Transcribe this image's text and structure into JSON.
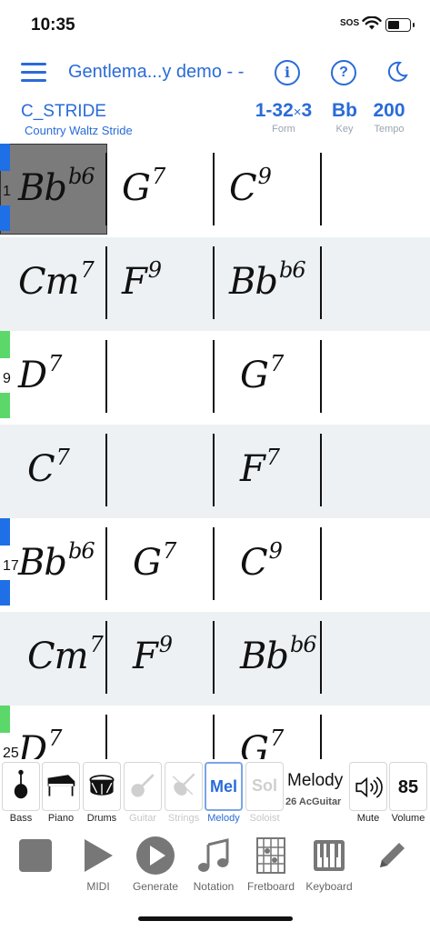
{
  "status": {
    "time": "10:35",
    "sos": "SOS"
  },
  "nav": {
    "title": "Gentlema...y demo - -",
    "info_glyph": "i",
    "help_glyph": "?"
  },
  "style": {
    "name": "C_STRIDE",
    "description": "Country Waltz Stride",
    "form": {
      "range": "1-32",
      "times": "×",
      "repeat": "3",
      "label": "Form"
    },
    "key": {
      "value": "Bb",
      "label": "Key"
    },
    "tempo": {
      "value": "200",
      "label": "Tempo"
    }
  },
  "chart": {
    "rows": [
      {
        "bar_number": "1",
        "marker": "blue",
        "bars": [
          {
            "root": "Bb",
            "ext": "b6"
          },
          {
            "root": "G",
            "ext": "7"
          },
          {
            "root": "C",
            "ext": "9"
          },
          {
            "root": "",
            "ext": ""
          }
        ]
      },
      {
        "bar_number": "",
        "marker": "",
        "bars": [
          {
            "root": "Cm",
            "ext": "7"
          },
          {
            "root": "F",
            "ext": "9"
          },
          {
            "root": "Bb",
            "ext": "b6"
          },
          {
            "root": "",
            "ext": ""
          }
        ]
      },
      {
        "bar_number": "9",
        "marker": "green",
        "bars": [
          {
            "root": "D",
            "ext": "7"
          },
          {
            "root": "",
            "ext": ""
          },
          {
            "root": "G",
            "ext": "7"
          },
          {
            "root": "",
            "ext": ""
          }
        ]
      },
      {
        "bar_number": "",
        "marker": "",
        "bars": [
          {
            "root": "C",
            "ext": "7"
          },
          {
            "root": "",
            "ext": ""
          },
          {
            "root": "F",
            "ext": "7"
          },
          {
            "root": "",
            "ext": ""
          }
        ]
      },
      {
        "bar_number": "17",
        "marker": "blue",
        "bars": [
          {
            "root": "Bb",
            "ext": "b6"
          },
          {
            "root": "G",
            "ext": "7"
          },
          {
            "root": "C",
            "ext": "9"
          },
          {
            "root": "",
            "ext": ""
          }
        ]
      },
      {
        "bar_number": "",
        "marker": "",
        "bars": [
          {
            "root": "Cm",
            "ext": "7"
          },
          {
            "root": "F",
            "ext": "9"
          },
          {
            "root": "Bb",
            "ext": "b6"
          },
          {
            "root": "",
            "ext": ""
          }
        ]
      },
      {
        "bar_number": "25",
        "marker": "green",
        "bars": [
          {
            "root": "D",
            "ext": "7"
          },
          {
            "root": "",
            "ext": ""
          },
          {
            "root": "G",
            "ext": "7"
          },
          {
            "root": "",
            "ext": ""
          }
        ]
      }
    ]
  },
  "mixer": {
    "bass": "Bass",
    "piano": "Piano",
    "drums": "Drums",
    "guitar": "Guitar",
    "strings": "Strings",
    "melody_btn": "Mel",
    "melody": "Melody",
    "soloist_btn": "Sol",
    "soloist": "Soloist",
    "track_name": "Melody",
    "track_instrument": "26 AcGuitar",
    "mute": "Mute",
    "volume_value": "85",
    "volume": "Volume"
  },
  "toolbar": {
    "stop": "",
    "midi": "MIDI",
    "generate": "Generate",
    "notation": "Notation",
    "fretboard": "Fretboard",
    "keyboard": "Keyboard",
    "edit": ""
  },
  "colors": {
    "accent": "#2a6bd8",
    "marker_blue": "#1f6fe6",
    "marker_green": "#5cd86a",
    "row_shade": "#edf1f4",
    "selected_bar": "#7b7b7b"
  }
}
